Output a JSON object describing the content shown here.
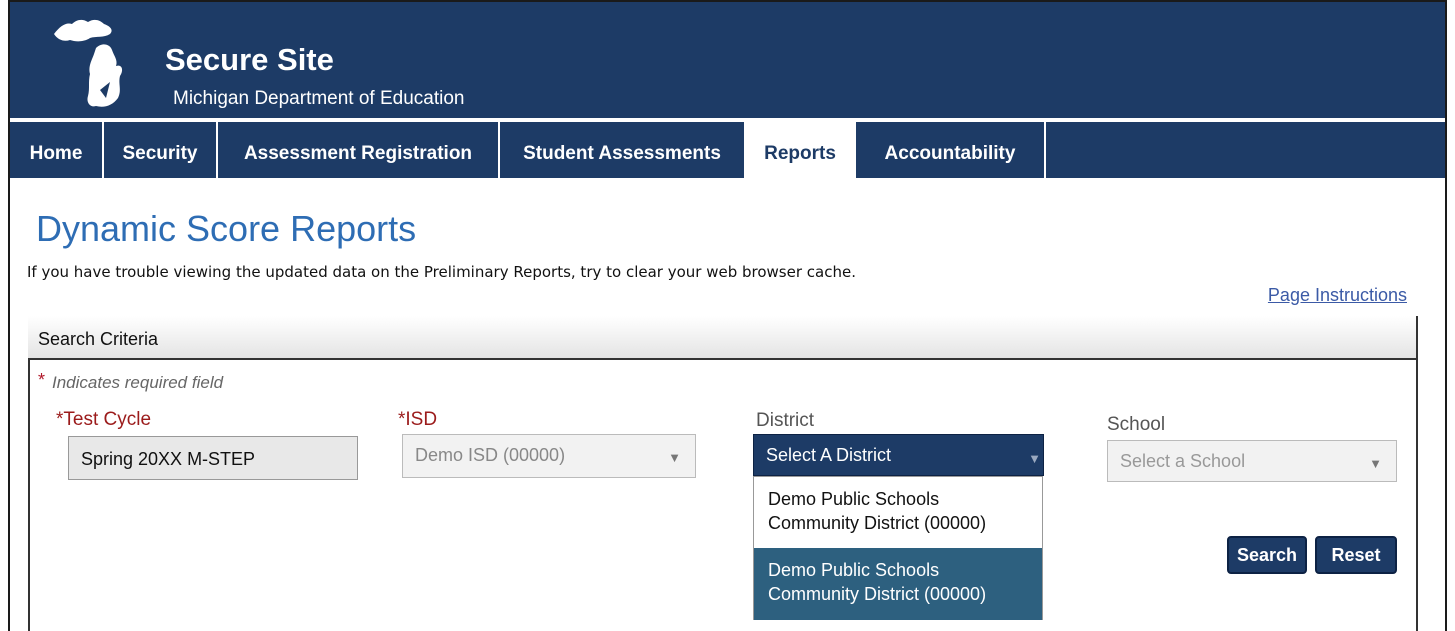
{
  "colors": {
    "brand_navy": "#1d3b66",
    "heading_blue": "#2e6db4",
    "required_red": "#9b1b1b",
    "link_blue": "#3b5aa6",
    "selected_option_bg": "#2d607f"
  },
  "header": {
    "title": "Secure Site",
    "subtitle": "Michigan Department of Education",
    "logo_icon": "michigan-state-icon"
  },
  "nav": {
    "items": [
      {
        "label": "Home"
      },
      {
        "label": "Security"
      },
      {
        "label": "Assessment Registration"
      },
      {
        "label": "Student Assessments"
      },
      {
        "label": "Reports",
        "active": true
      },
      {
        "label": "Accountability"
      }
    ]
  },
  "page": {
    "title": "Dynamic Score Reports",
    "notice": "If you have trouble viewing the updated data on the Preliminary Reports, try to clear your web browser cache.",
    "instructions_link": "Page Instructions"
  },
  "search": {
    "section_title": "Search Criteria",
    "required_marker": "*",
    "required_note": "Indicates required field",
    "test_cycle": {
      "label": "*Test Cycle",
      "value": "Spring 20XX M-STEP"
    },
    "isd": {
      "label": "*ISD",
      "value": "Demo ISD (00000)"
    },
    "district": {
      "label": "District",
      "value": "Select A District",
      "options": [
        {
          "line1": "Demo Public Schools",
          "line2": "Community District (00000)"
        },
        {
          "line1": "Demo Public Schools",
          "line2": "Community District (00000)",
          "highlighted": true
        }
      ]
    },
    "school": {
      "label": "School",
      "value": "Select a School"
    },
    "dropdown_arrow": "▼",
    "search_button": "Search",
    "reset_button": "Reset"
  }
}
